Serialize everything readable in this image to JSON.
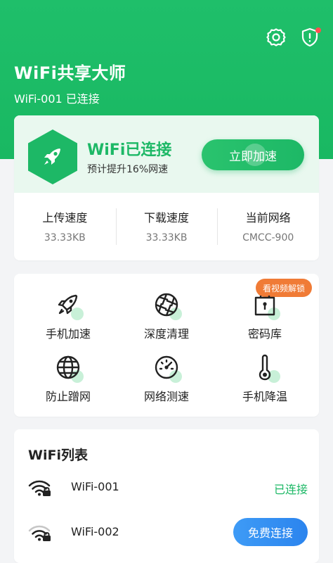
{
  "header": {
    "app_title": "WiFi共享大师",
    "connected_subtitle": "WiFi-001 已连接",
    "icons": [
      "settings-icon",
      "shield-alert-icon"
    ],
    "brand_color": "#1db866"
  },
  "status_card": {
    "title": "WiFi已连接",
    "description": "预计提升16%网速",
    "boost_button": "立即加速",
    "stats": [
      {
        "label": "上传速度",
        "value": "33.33KB"
      },
      {
        "label": "下载速度",
        "value": "33.33KB"
      },
      {
        "label": "当前网络",
        "value": "CMCC-900"
      }
    ]
  },
  "tools": {
    "unlock_badge": "看视频解锁",
    "items": [
      {
        "label": "手机加速",
        "icon": "rocket-icon"
      },
      {
        "label": "深度清理",
        "icon": "aperture-icon"
      },
      {
        "label": "密码库",
        "icon": "lock-box-icon"
      },
      {
        "label": "防止蹭网",
        "icon": "globe-icon"
      },
      {
        "label": "网络测速",
        "icon": "speedometer-icon"
      },
      {
        "label": "手机降温",
        "icon": "thermometer-icon"
      }
    ]
  },
  "wifi_list": {
    "title": "WiFi列表",
    "items": [
      {
        "name": "WiFi-001",
        "status": "已连接"
      },
      {
        "name": "WiFi-002",
        "action": "免费连接"
      }
    ]
  }
}
